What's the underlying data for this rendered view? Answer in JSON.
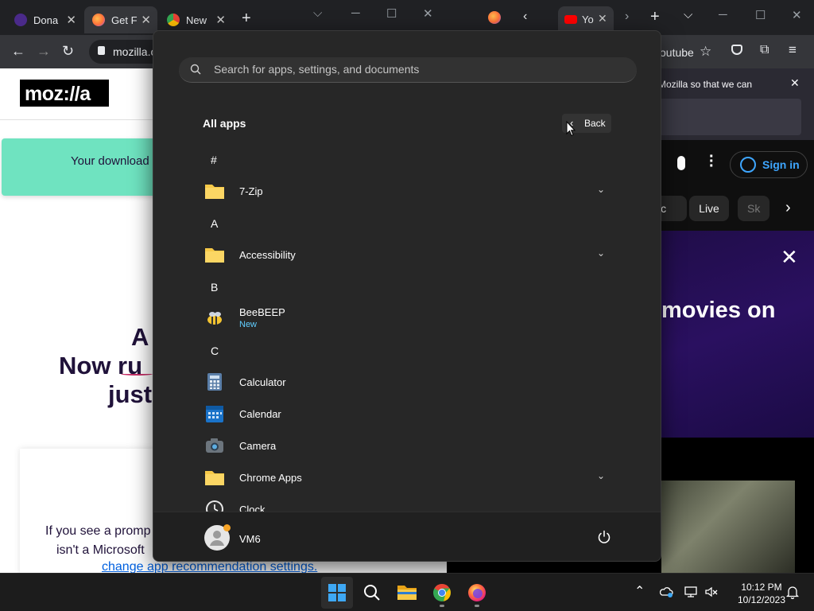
{
  "left_browser": {
    "tabs": [
      {
        "label": "Dona"
      },
      {
        "label": "Get F"
      },
      {
        "label": "New"
      }
    ],
    "url": "mozilla.o",
    "logo": "moz://a",
    "download_banner": "Your download",
    "hero_lines": [
      "A",
      "Now ru",
      "just"
    ],
    "prompt_lines": [
      "If you see a promp",
      "isn't a Microsoft"
    ],
    "prompt_link": "change app recommendation settings."
  },
  "right_browser": {
    "tab_label": "Yo",
    "url_fragment": "outube",
    "notice_text": "Mozilla so that we can",
    "sign_in": "Sign in",
    "chips": [
      "ic",
      "Live",
      "Sk"
    ],
    "promo_text": "movies on"
  },
  "start_menu": {
    "search_placeholder": "Search for apps, settings, and documents",
    "title": "All apps",
    "back_label": "Back",
    "sections": [
      {
        "letter": "#",
        "apps": [
          {
            "name": "7-Zip",
            "folder": true
          }
        ]
      },
      {
        "letter": "A",
        "apps": [
          {
            "name": "Accessibility",
            "folder": true
          }
        ]
      },
      {
        "letter": "B",
        "apps": [
          {
            "name": "BeeBEEP",
            "badge": "New"
          }
        ]
      },
      {
        "letter": "C",
        "apps": [
          {
            "name": "Calculator"
          },
          {
            "name": "Calendar"
          },
          {
            "name": "Camera"
          },
          {
            "name": "Chrome Apps",
            "folder": true
          },
          {
            "name": "Clock"
          }
        ]
      }
    ],
    "user_name": "VM6"
  },
  "taskbar": {
    "time": "10:12 PM",
    "date": "10/12/2023"
  },
  "colors": {
    "accent_blue": "#60cdff",
    "folder_yellow": "#f7c948",
    "mozilla_banner": "#6fe3c0",
    "start_bg": "#272727"
  }
}
